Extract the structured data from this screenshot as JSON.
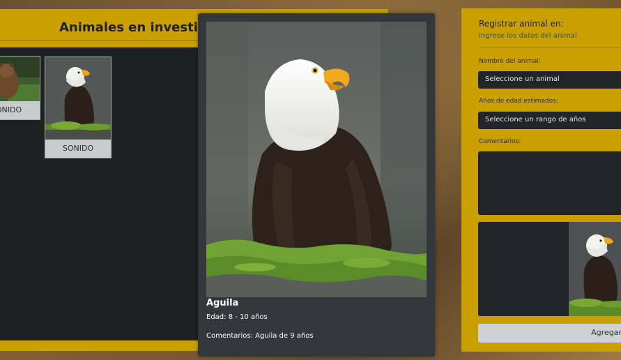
{
  "left_panel": {
    "title": "Animales en investigación",
    "cards": [
      {
        "animal": "Oso",
        "sound_label": "SONIDO"
      },
      {
        "animal": "Aguila",
        "sound_label": "SONIDO"
      }
    ]
  },
  "modal": {
    "name": "Aguila",
    "age_text": "Edad: 8 - 10 años",
    "comments_text": "Comentarios: Aguila de 9 años"
  },
  "form": {
    "title": "Registrar animal en:",
    "subtitle": "Ingrese los datos del animal",
    "name_label": "Nombre del animal:",
    "name_select_value": "Seleccione un animal",
    "age_label": "Años de edad estimados:",
    "age_select_value": "Seleccione un rango de años",
    "comments_label": "Comentarios:",
    "comments_value": "",
    "submit_label": "Agregar"
  },
  "colors": {
    "panel_yellow": "#c9a000",
    "dark_panel": "#1e2124",
    "modal_bg": "#33363b"
  }
}
